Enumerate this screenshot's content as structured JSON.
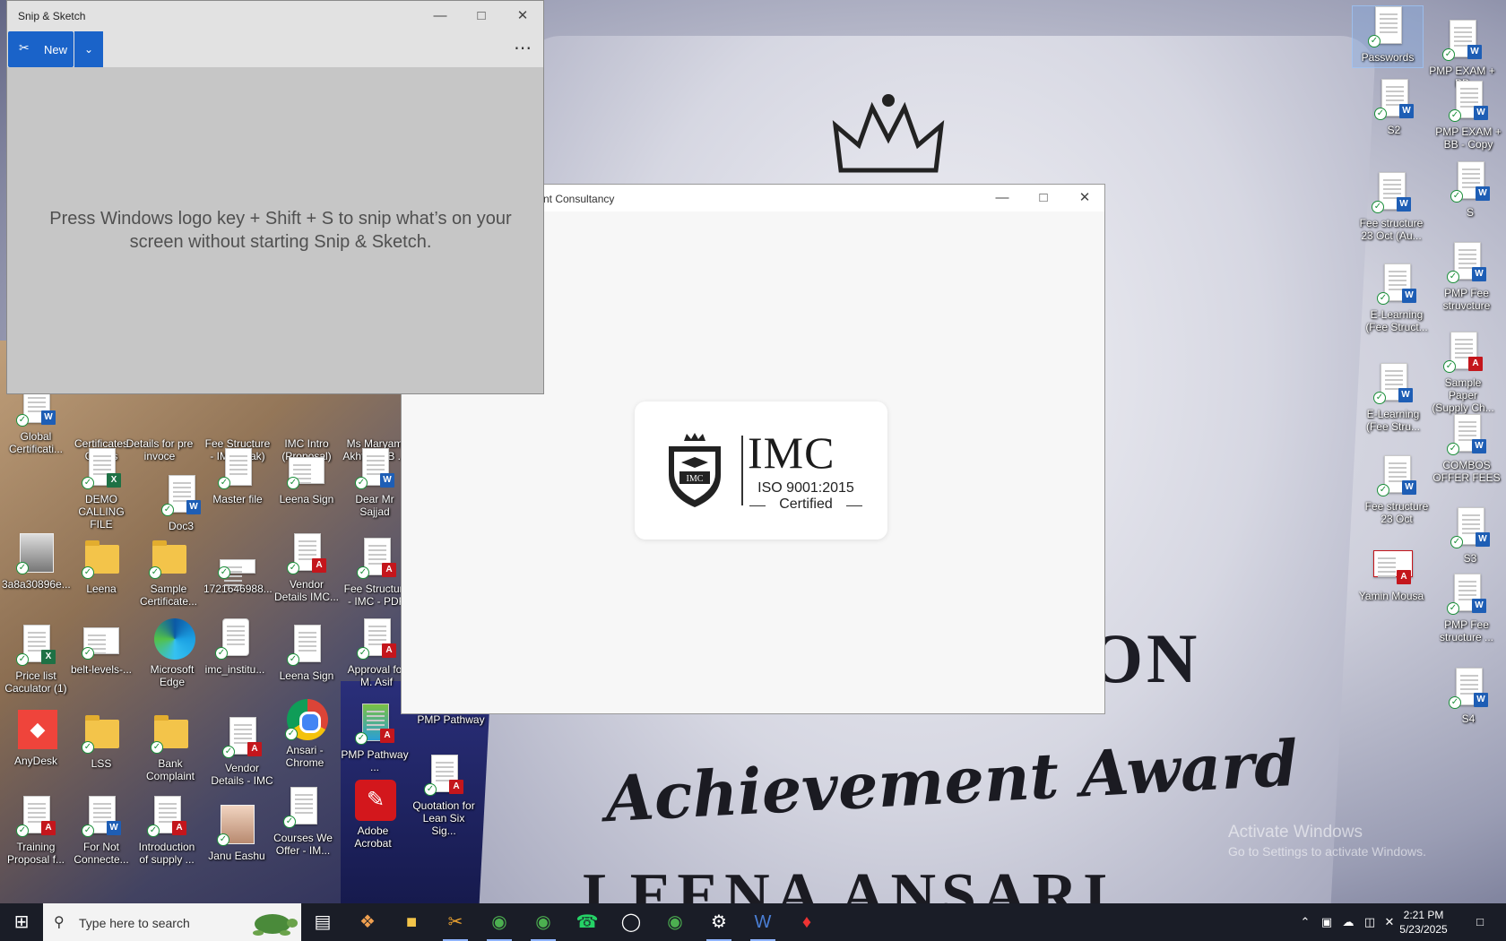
{
  "desktop": {
    "award_text_ion": "ION",
    "award_text_achievement": "Achievement Award",
    "award_text_name": "LEENA ANSARI",
    "activate_title": "Activate Windows",
    "activate_sub": "Go to Settings to activate Windows.",
    "icons": {
      "global_cert": "Global Certificati...",
      "certificates_clients": "Certificates Clients",
      "details_pre_invoice": "Details for pre invoce",
      "fee_structure_pak": "Fee Structure - IMC (Pak)",
      "imc_intro": "IMC Intro (Proposal)",
      "ms_maryam": "Ms Maryam Akhtar (BB ...",
      "demo_calling": "DEMO CALLING FILE",
      "doc3": "Doc3",
      "master_file": "Master file",
      "leena_sign_1": "Leena Sign",
      "dear_mr_sajjad": "Dear Mr Sajjad",
      "img_3a8a": "3a8a30896e...",
      "leena_folder": "Leena",
      "sample_certificate": "Sample Certificate...",
      "num_1721": "1721646988...",
      "vendor_details_imc_1": "Vendor Details IMC...",
      "fee_structure_pdf": "Fee Structure - IMC - PDF",
      "price_list": "Price list Caculator (1)",
      "belt_levels": "belt-levels-...",
      "ms_edge": "Microsoft Edge",
      "imc_institu": "imc_institu...",
      "leena_sign_2": "Leena Sign",
      "approval_asif": "Approval for M. Asif",
      "anydesk": "AnyDesk",
      "lss": "LSS",
      "bank_complaint": "Bank Complaint",
      "vendor_details_imc_2": "Vendor Details - IMC",
      "ansari_chrome": "Ansari - Chrome",
      "pmp_pathway_1": "PMP Pathway ...",
      "pmp_pathway_2": "PMP Pathway",
      "training_proposal": "Training Proposal f...",
      "for_not_connected": "For Not Connecte...",
      "intro_supply": "Introduction of supply ...",
      "janu_eashu": "Janu Eashu",
      "courses_we_offer": "Courses We Offer - IM...",
      "adobe_acrobat": "Adobe Acrobat",
      "quotation_lean": "Quotation for Lean Six Sig...",
      "passwords": "Passwords",
      "s2": "S2",
      "fee_23oct_au": "Fee structure 23 Oct (Au...",
      "elearning_1": "E-Learning (Fee Struct...",
      "elearning_2": "E-Learning (Fee Stru...",
      "fee_23oct": "Fee structure 23 Oct",
      "yamin_mousa": "Yamin Mousa",
      "pmp_exam_bb": "PMP EXAM + BB",
      "pmp_exam_bb_copy": "PMP EXAM + BB - Copy",
      "s": "S",
      "pmp_fee_struvcture": "PMP Fee struvcture",
      "sample_paper": "Sample Paper (Supply Ch...",
      "combos": "COMBOS OFFER FEES",
      "s3": "S3",
      "pmp_fee_structure": "PMP Fee structure ...",
      "s4": "S4"
    }
  },
  "snip": {
    "title": "Snip & Sketch",
    "new_label": "New",
    "more_label": "⋯",
    "message": "Press Windows logo key + Shift + S to snip what’s on your screen without starting Snip & Sketch."
  },
  "imc_window": {
    "title": "nt Consultancy",
    "logo_name": "IMC",
    "logo_iso": "ISO 9001:2015",
    "logo_certified": "Certified"
  },
  "taskbar": {
    "search_placeholder": "Type here to search",
    "time": "2:21 PM",
    "date": "5/23/2025"
  },
  "colors": {
    "accent": "#1a63c9",
    "taskbar": "#1a1d27"
  }
}
